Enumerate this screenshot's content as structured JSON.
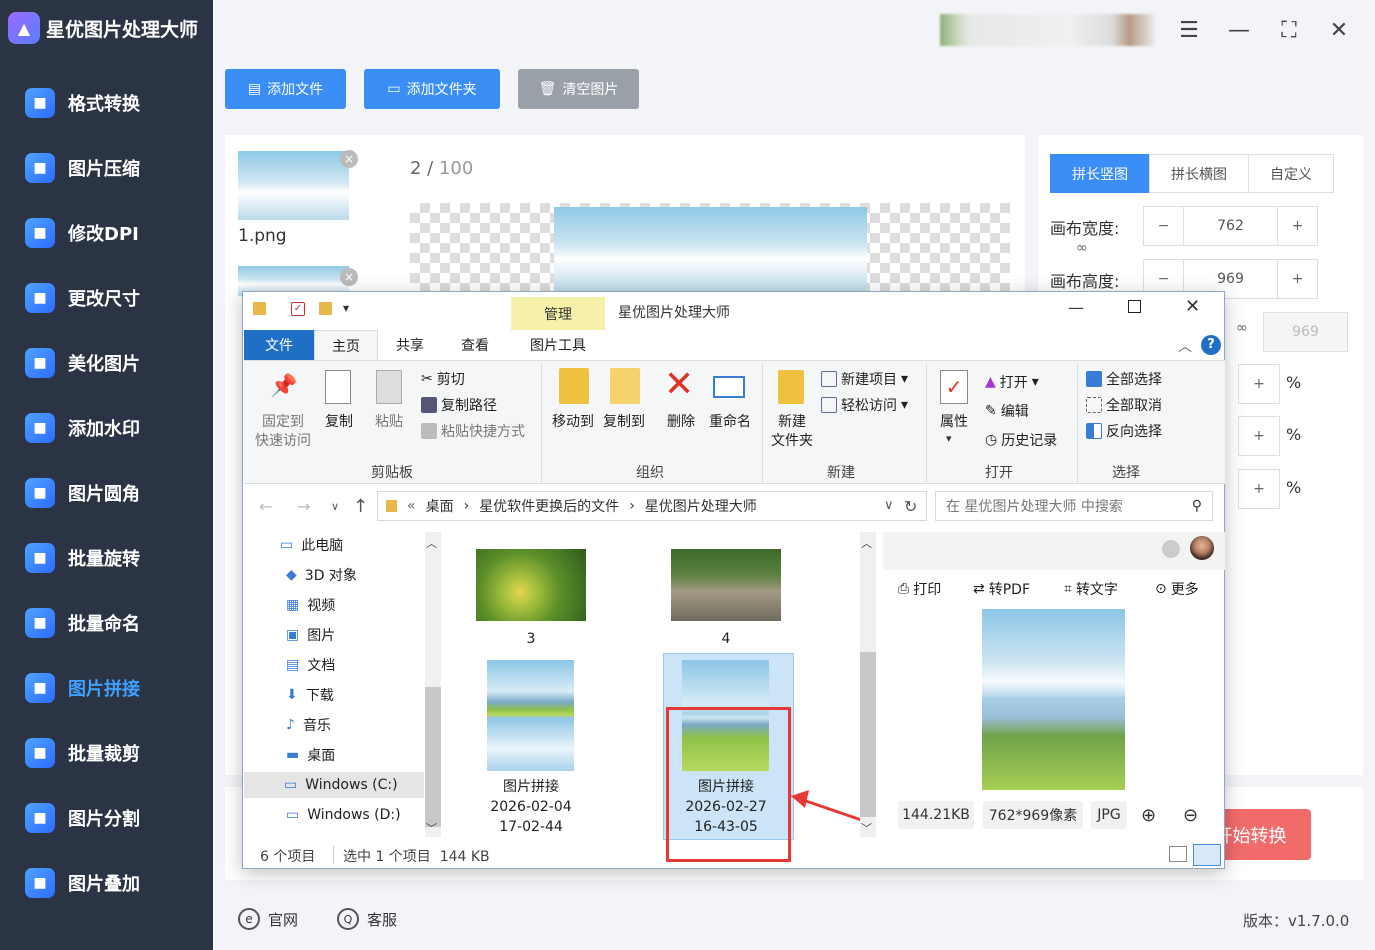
{
  "app": {
    "title": "星优图片处理大师",
    "version": "版本：v1.7.0.0"
  },
  "sidebar": {
    "items": [
      {
        "label": "格式转换",
        "icon": "image-convert-icon"
      },
      {
        "label": "图片压缩",
        "icon": "compress-icon"
      },
      {
        "label": "修改DPI",
        "icon": "dpi-icon"
      },
      {
        "label": "更改尺寸",
        "icon": "resize-icon"
      },
      {
        "label": "美化图片",
        "icon": "beautify-icon"
      },
      {
        "label": "添加水印",
        "icon": "watermark-icon"
      },
      {
        "label": "图片圆角",
        "icon": "round-corner-icon"
      },
      {
        "label": "批量旋转",
        "icon": "rotate-icon"
      },
      {
        "label": "批量命名",
        "icon": "rename-icon"
      },
      {
        "label": "图片拼接",
        "icon": "stitch-icon",
        "active": true
      },
      {
        "label": "批量裁剪",
        "icon": "crop-icon"
      },
      {
        "label": "图片分割",
        "icon": "split-icon"
      },
      {
        "label": "图片叠加",
        "icon": "overlay-icon"
      }
    ]
  },
  "toolbar": {
    "add_file": "添加文件",
    "add_folder": "添加文件夹",
    "clear": "清空图片"
  },
  "files": {
    "first_name": "1.png",
    "counter_current": "2",
    "counter_total": "100"
  },
  "settings": {
    "modes": [
      "拼长竖图",
      "拼长横图",
      "自定义"
    ],
    "width_label": "画布宽度:",
    "width_value": "762",
    "height_label": "画布高度:",
    "height_value": "969",
    "locked_value": "969",
    "percent": "%"
  },
  "start_button": "开始转换",
  "footer": {
    "website": "官网",
    "support": "客服"
  },
  "explorer": {
    "title": "星优图片处理大师",
    "manage_tab": "管理",
    "tabs": [
      "文件",
      "主页",
      "共享",
      "查看",
      "图片工具"
    ],
    "ribbon": {
      "pin": "固定到\n快速访问",
      "copy": "复制",
      "paste": "粘贴",
      "cut": "剪切",
      "copy_path": "复制路径",
      "paste_shortcut": "粘贴快捷方式",
      "move_to": "移动到",
      "copy_to": "复制到",
      "delete": "删除",
      "rename": "重命名",
      "new_folder": "新建\n文件夹",
      "new_item": "新建项目",
      "easy_access": "轻松访问",
      "properties": "属性",
      "open": "打开",
      "edit": "编辑",
      "history": "历史记录",
      "select_all": "全部选择",
      "select_none": "全部取消",
      "invert": "反向选择",
      "groups": [
        "剪贴板",
        "组织",
        "新建",
        "打开",
        "选择"
      ]
    },
    "breadcrumb": [
      "桌面",
      "星优软件更换后的文件",
      "星优图片处理大师"
    ],
    "search_placeholder": "在 星优图片处理大师 中搜索",
    "tree": [
      "此电脑",
      "3D 对象",
      "视频",
      "图片",
      "文档",
      "下载",
      "音乐",
      "桌面",
      "Windows (C:)",
      "Windows (D:)"
    ],
    "files": [
      {
        "name": "3"
      },
      {
        "name": "4"
      },
      {
        "name": "图片拼接\n2026-02-04\n17-02-44"
      },
      {
        "name": "图片拼接\n2026-02-27\n16-43-05",
        "selected": true
      }
    ],
    "preview": {
      "print": "打印",
      "to_pdf": "转PDF",
      "to_text": "转文字",
      "more": "更多",
      "size": "144.21KB",
      "dimensions": "762*969像素",
      "format": "JPG"
    },
    "status": {
      "count": "6 个项目",
      "selection": "选中 1 个项目  144 KB"
    }
  },
  "colors": {
    "accent": "#3a8ef6",
    "sidebar": "#2b3445",
    "highlight": "#e53935",
    "start": "#f26b6b"
  }
}
